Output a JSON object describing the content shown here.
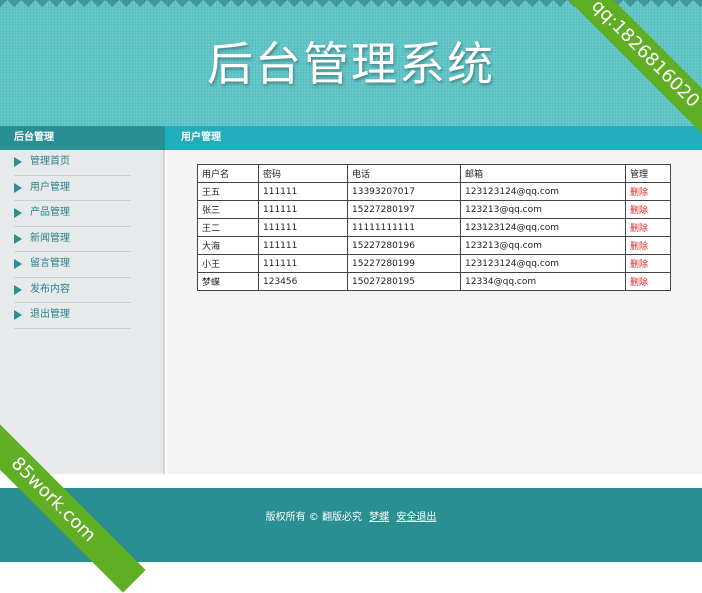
{
  "header": {
    "title": "后台管理系统"
  },
  "ribbons": {
    "top_right": "qq:1826816020",
    "bottom_left": "85work.com"
  },
  "sidebar": {
    "title": "后台管理",
    "items": [
      {
        "label": "管理首页"
      },
      {
        "label": "用户管理"
      },
      {
        "label": "产品管理"
      },
      {
        "label": "新闻管理"
      },
      {
        "label": "留言管理"
      },
      {
        "label": "发布内容"
      },
      {
        "label": "退出管理"
      }
    ]
  },
  "main": {
    "title": "用户管理",
    "table": {
      "headers": [
        "用户名",
        "密码",
        "电话",
        "邮箱",
        "管理"
      ],
      "rows": [
        {
          "name": "王五",
          "password": "111111",
          "phone": "13393207017",
          "email": "123123124@qq.com",
          "action": "删除"
        },
        {
          "name": "张三",
          "password": "111111",
          "phone": "15227280197",
          "email": "123213@qq.com",
          "action": "删除"
        },
        {
          "name": "王二",
          "password": "111111",
          "phone": "11111111111",
          "email": "123123124@qq.com",
          "action": "删除"
        },
        {
          "name": "大海",
          "password": "111111",
          "phone": "15227280196",
          "email": "123213@qq.com",
          "action": "删除"
        },
        {
          "name": "小王",
          "password": "111111",
          "phone": "15227280199",
          "email": "123123124@qq.com",
          "action": "删除"
        },
        {
          "name": "梦蝶",
          "password": "123456",
          "phone": "15027280195",
          "email": "12334@qq.com",
          "action": "删除"
        }
      ]
    }
  },
  "footer": {
    "copyright": "版权所有 © 翻版必究",
    "user_link": "梦蝶",
    "logout_link": "安全退出"
  },
  "colors": {
    "header_bg": "#5fc6c8",
    "sidebar_head": "#2a8f93",
    "main_head": "#22adbd",
    "footer_bg": "#2a8f93",
    "delete_link": "#e0282a",
    "ribbon": "#5fae24"
  }
}
